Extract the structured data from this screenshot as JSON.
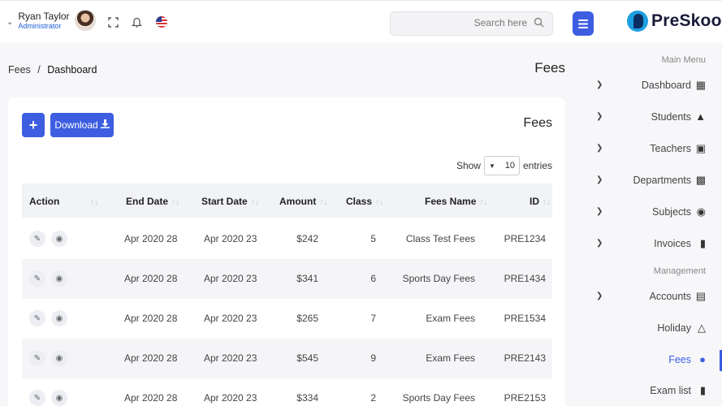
{
  "header": {
    "user_name": "Ryan Taylor",
    "user_role": "Administrator",
    "search_placeholder": "Search here",
    "logo_text": "PreSkool",
    "icons": [
      "chevron-down-icon",
      "fullscreen-icon",
      "bell-icon",
      "us-flag-icon",
      "search-icon",
      "hamburger-icon"
    ]
  },
  "breadcrumb": {
    "parent": "Fees",
    "separator": "/",
    "current": "Dashboard"
  },
  "page_title": "Fees",
  "card": {
    "title": "Fees",
    "add_label": "+",
    "download_label": "Download",
    "show_label": "Show",
    "entries_label": "entries",
    "entries_value": "10"
  },
  "table": {
    "columns": [
      "Action",
      "End Date",
      "Start Date",
      "Amount",
      "Class",
      "Fees Name",
      "ID"
    ],
    "rows": [
      {
        "end": "Apr 2020 28",
        "start": "Apr 2020 23",
        "amount": "$242",
        "class": "5",
        "name": "Class Test Fees",
        "id": "PRE1234"
      },
      {
        "end": "Apr 2020 28",
        "start": "Apr 2020 23",
        "amount": "$341",
        "class": "6",
        "name": "Sports Day Fees",
        "id": "PRE1434"
      },
      {
        "end": "Apr 2020 28",
        "start": "Apr 2020 23",
        "amount": "$265",
        "class": "7",
        "name": "Exam Fees",
        "id": "PRE1534"
      },
      {
        "end": "Apr 2020 28",
        "start": "Apr 2020 23",
        "amount": "$545",
        "class": "9",
        "name": "Exam Fees",
        "id": "PRE2143"
      },
      {
        "end": "Apr 2020 28",
        "start": "Apr 2020 23",
        "amount": "$334",
        "class": "2",
        "name": "Sports Day Fees",
        "id": "PRE2153"
      }
    ]
  },
  "sidebar": {
    "main_menu_title": "Main Menu",
    "management_title": "Management",
    "items": [
      {
        "label": "Dashboard",
        "icon": "dashboard-icon"
      },
      {
        "label": "Students",
        "icon": "graduation-cap-icon"
      },
      {
        "label": "Teachers",
        "icon": "chalkboard-teacher-icon"
      },
      {
        "label": "Departments",
        "icon": "building-icon"
      },
      {
        "label": "Subjects",
        "icon": "book-reader-icon"
      },
      {
        "label": "Invoices",
        "icon": "clipboard-icon"
      },
      {
        "label": "Accounts",
        "icon": "file-invoice-icon"
      },
      {
        "label": "Holiday",
        "icon": "holiday-icon"
      },
      {
        "label": "Fees",
        "icon": "comment-dollar-icon"
      },
      {
        "label": "Exam list",
        "icon": "clipboard-list-icon"
      }
    ]
  },
  "colors": {
    "accent": "#3d5ee1",
    "background": "#f7f7fa",
    "card": "#ffffff"
  }
}
